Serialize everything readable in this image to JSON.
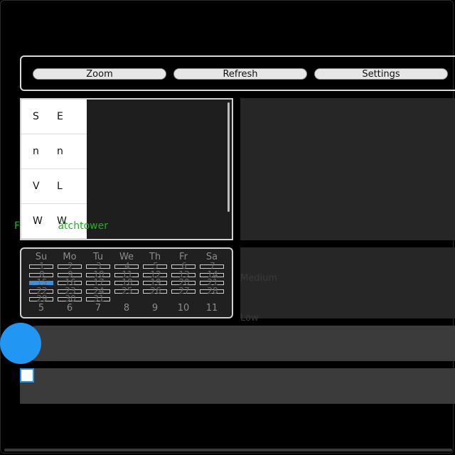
{
  "toolbar": {
    "buttons": [
      "Zoom",
      "Refresh",
      "Settings"
    ]
  },
  "list": {
    "rows": [
      {
        "a": "S",
        "b": "E"
      },
      {
        "a": "n",
        "b": "n"
      },
      {
        "a": "V",
        "b": "L"
      },
      {
        "a": "W",
        "b": "W"
      }
    ],
    "overlay_label": "F            atchtower"
  },
  "calendar": {
    "weekdays": [
      "Su",
      "Mo",
      "Tu",
      "We",
      "Th",
      "Fr",
      "Sa"
    ],
    "weeks": [
      [
        "1",
        "2",
        "3",
        "4",
        "5",
        "6",
        "7"
      ],
      [
        "8",
        "9",
        "10",
        "11",
        "12",
        "13",
        "14"
      ],
      [
        "15",
        "16",
        "17",
        "18",
        "19",
        "20",
        "21"
      ],
      [
        "22",
        "23",
        "24",
        "25",
        "26",
        "27",
        "28"
      ],
      [
        "29",
        "30",
        "31"
      ]
    ],
    "trailing": [
      "5",
      "6",
      "7",
      "8",
      "9",
      "10",
      "11"
    ],
    "selected_day": "15"
  },
  "levels": {
    "medium": "Medium",
    "low": "Low"
  },
  "slider": {
    "value_fraction": 0.0
  },
  "colors": {
    "accent": "#2196f3",
    "label_green": "#1fb01f"
  }
}
